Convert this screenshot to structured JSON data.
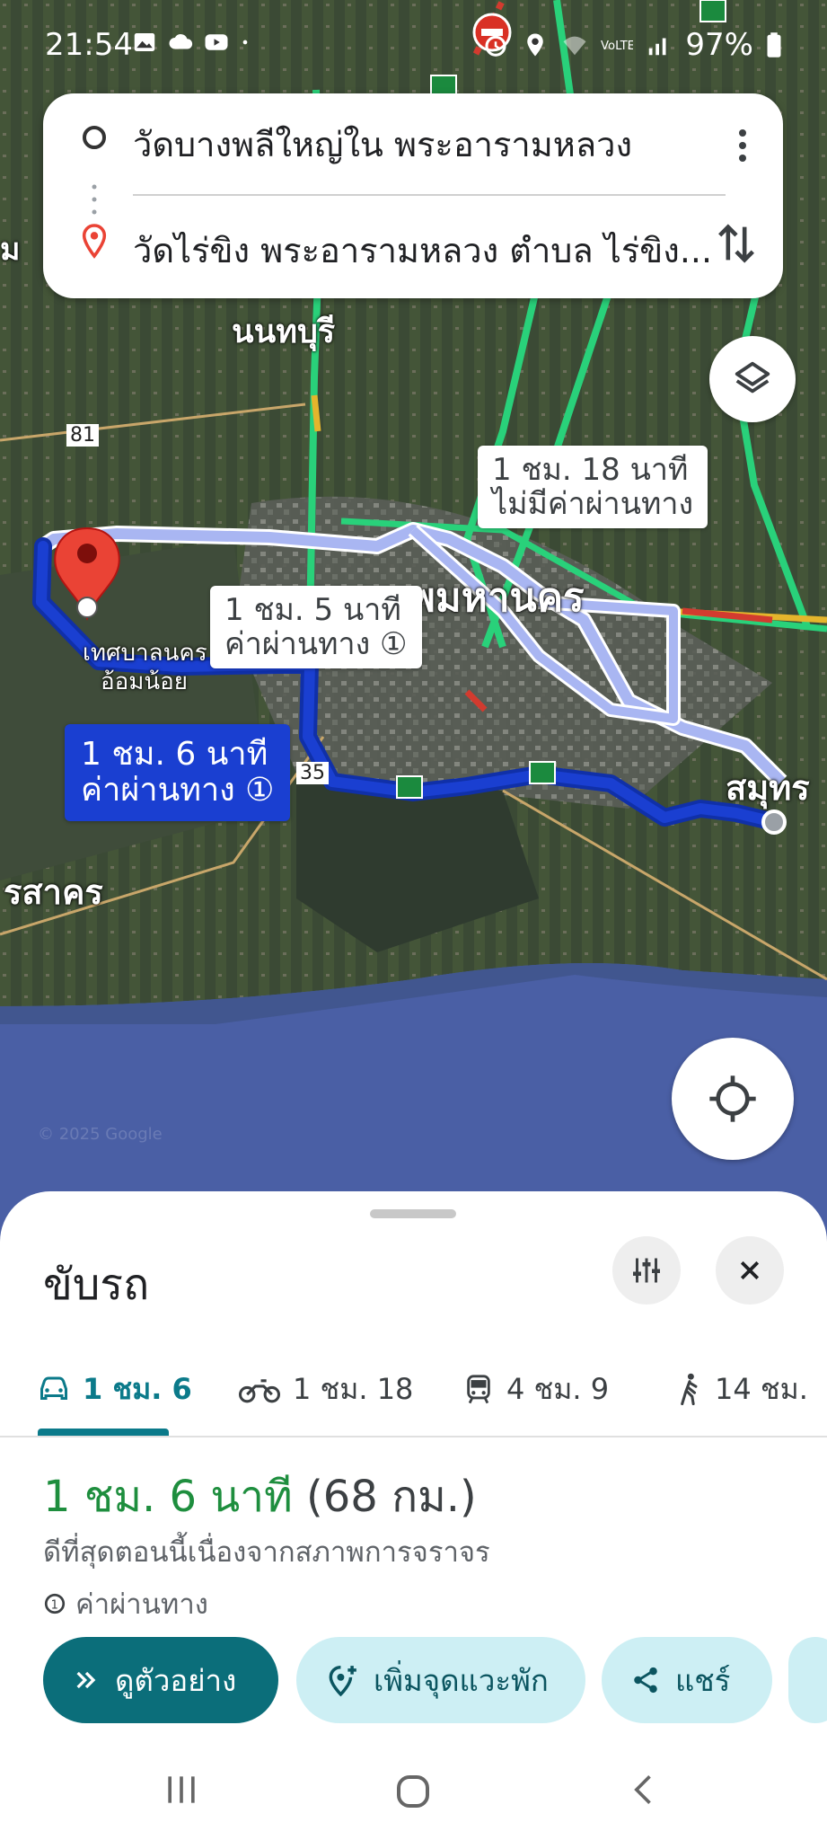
{
  "status_bar": {
    "time": "21:54",
    "battery": "97%",
    "icons_left": [
      "gallery-icon",
      "cloud-icon",
      "youtube-icon",
      "dot-icon"
    ],
    "icons_right": [
      "do-not-disturb-icon",
      "alarm-icon",
      "location-icon",
      "wifi-icon",
      "volte-icon",
      "signal-icon",
      "battery-icon"
    ]
  },
  "search": {
    "origin": "วัดบางพลีใหญ่ใน พระอารามหลวง",
    "destination": "วัดไร่ขิง พระอารามหลวง ตำบล ไร่ขิง..."
  },
  "map": {
    "labels": {
      "nonthaburi": "นนทบุรี",
      "bangkok": "กรุงเทพมหานคร",
      "samut_sakhon": "รสาคร",
      "samut_prakan": "สมุทร",
      "om_noi_1": "เทศบาลนคร",
      "om_noi_2": "อ้อมน้อย",
      "road_81": "81",
      "road_35": "35",
      "left_edge": "ม",
      "watermark": "© 2025 Google"
    },
    "callouts": {
      "primary_line1": "1 ชม. 6 นาที",
      "primary_line2": "ค่าผ่านทาง ①",
      "alt1_line1": "1 ชม. 5 นาที",
      "alt1_line2": "ค่าผ่านทาง ①",
      "alt2_line1": "1 ชม. 18 นาที",
      "alt2_line2": "ไม่มีค่าผ่านทาง"
    },
    "colors": {
      "route_primary": "#1a3fd1",
      "route_alt": "#a9b6f2",
      "traffic_green": "#29d17a",
      "sea": "#4a5fa5"
    }
  },
  "sheet": {
    "title": "ขับรถ",
    "tabs": [
      {
        "label": "1 ชม. 6",
        "icon": "car-icon"
      },
      {
        "label": "1 ชม. 18",
        "icon": "motorcycle-icon"
      },
      {
        "label": "4 ชม. 9",
        "icon": "train-icon"
      },
      {
        "label": "14 ชม.",
        "icon": "walk-icon"
      }
    ],
    "duration": "1 ชม. 6 นาที",
    "distance": "(68 กม.)",
    "reason": "ดีที่สุดตอนนี้เนื่องจากสภาพการจราจร",
    "toll": "ค่าผ่านทาง",
    "actions": {
      "preview": "ดูตัวอย่าง",
      "add_stop": "เพิ่มจุดแวะพัก",
      "share": "แชร์"
    },
    "accent": "#0b6e7a"
  }
}
